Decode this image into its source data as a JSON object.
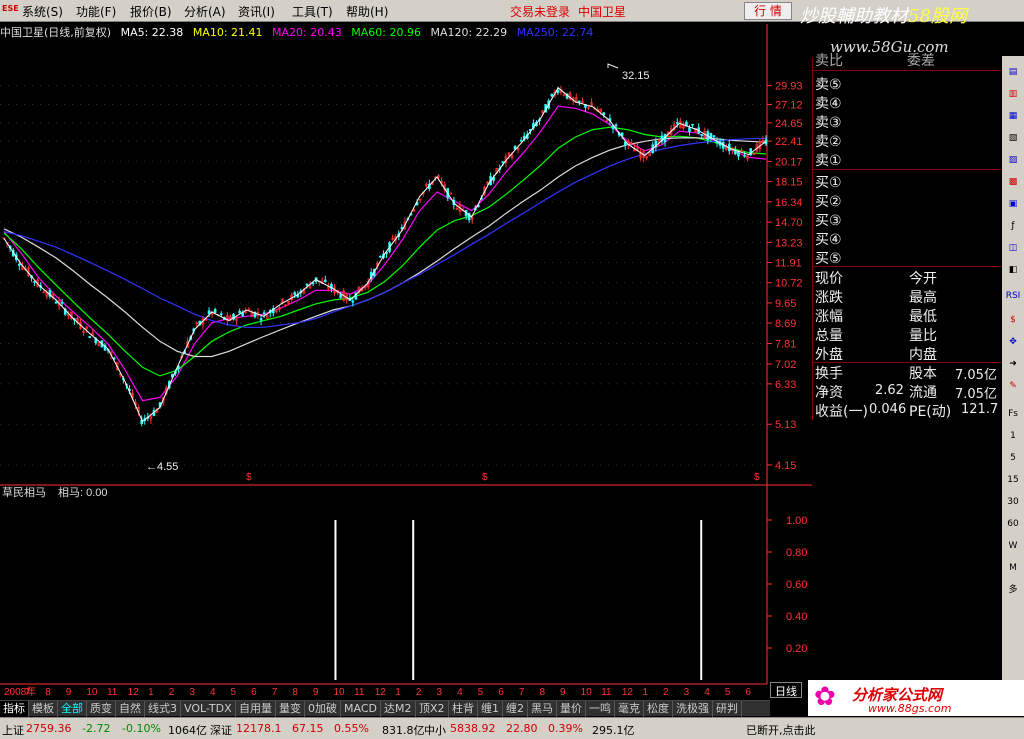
{
  "menubar": {
    "logo": "ESE",
    "items": [
      "系统(S)",
      "功能(F)",
      "报价(B)",
      "分析(A)",
      "资讯(I)",
      "工具(T)",
      "帮助(H)"
    ],
    "status": "交易未登录",
    "stock_name": "中国卫星",
    "quote_button": "行 情"
  },
  "watermark": {
    "title_main": "炒股輔助教材",
    "title_accent": "58股网",
    "url": "www.58Gu.com"
  },
  "chart_header": {
    "title": "中国卫星(日线,前复权)",
    "ma": [
      {
        "label": "MA5: 22.38",
        "color": "#ffffff"
      },
      {
        "label": "MA10: 21.41",
        "color": "#ffff00"
      },
      {
        "label": "MA20: 20.43",
        "color": "#ff00ff"
      },
      {
        "label": "MA60: 20.96",
        "color": "#00ff00"
      },
      {
        "label": "MA120: 22.29",
        "color": "#dddddd"
      },
      {
        "label": "MA250: 22.74",
        "color": "#3333ff"
      }
    ]
  },
  "colors": {
    "up": "#ff3333",
    "down": "#33ffff",
    "axis": "#ff3333",
    "ma5": "#ffffff",
    "ma10": "#ffff00",
    "ma20": "#ff00ff",
    "ma60": "#00ff00",
    "ma120": "#dddddd",
    "ma250": "#3333ff"
  },
  "chart_data": [
    {
      "type": "line",
      "title": "中国卫星(日线,前复权)",
      "y_ticks": [
        "29.93",
        "27.12",
        "24.65",
        "22.41",
        "20.17",
        "18.15",
        "16.34",
        "14.70",
        "13.23",
        "11.91",
        "10.72",
        "9.65",
        "8.69",
        "7.81",
        "7.02",
        "6.33",
        "5.13",
        "4.15"
      ],
      "annotations": [
        {
          "label": "32.15"
        },
        {
          "label": "4.55"
        }
      ],
      "x_labels": [
        "2008年",
        "7",
        "8",
        "9",
        "10",
        "11",
        "12",
        "1",
        "2",
        "3",
        "4",
        "5",
        "6",
        "7",
        "8",
        "9",
        "10",
        "11",
        "12",
        "1",
        "2",
        "3",
        "4",
        "5",
        "6",
        "7",
        "8",
        "9",
        "10",
        "11",
        "12",
        "1",
        "2",
        "3",
        "4",
        "5",
        "6"
      ],
      "series": [
        {
          "name": "MA5",
          "values": [
            13.5,
            11.8,
            10.6,
            9.8,
            8.9,
            8.2,
            7.6,
            6.4,
            5.2,
            5.6,
            6.9,
            8.4,
            9.2,
            8.8,
            9.3,
            9.0,
            9.6,
            10.1,
            10.9,
            10.4,
            9.8,
            10.7,
            12.5,
            14.1,
            16.8,
            18.6,
            16.2,
            15.1,
            18.0,
            20.3,
            22.5,
            25.3,
            29.6,
            27.5,
            26.8,
            24.9,
            22.1,
            20.8,
            22.5,
            24.6,
            23.8,
            22.6,
            21.5,
            20.9,
            22.4
          ]
        },
        {
          "name": "MA20",
          "values": [
            14.0,
            12.5,
            11.0,
            10.0,
            9.2,
            8.5,
            7.8,
            6.8,
            5.8,
            5.9,
            6.6,
            7.8,
            8.7,
            8.9,
            9.0,
            9.1,
            9.4,
            9.8,
            10.3,
            10.3,
            10.1,
            10.6,
            11.8,
            13.4,
            15.6,
            17.2,
            16.4,
            15.6,
            17.0,
            19.1,
            21.1,
            23.6,
            26.9,
            26.6,
            25.8,
            24.4,
            22.4,
            21.3,
            22.0,
            23.6,
            23.4,
            22.5,
            21.4,
            20.6,
            20.4
          ]
        },
        {
          "name": "MA60",
          "values": [
            13.9,
            12.8,
            11.6,
            10.6,
            9.7,
            8.9,
            8.2,
            7.5,
            6.9,
            6.6,
            6.8,
            7.3,
            7.9,
            8.3,
            8.6,
            8.8,
            9.0,
            9.3,
            9.6,
            9.8,
            9.9,
            10.2,
            10.8,
            11.7,
            12.9,
            14.1,
            14.8,
            15.2,
            15.9,
            17.0,
            18.3,
            19.8,
            21.6,
            22.9,
            23.8,
            24.1,
            23.8,
            23.2,
            22.9,
            23.0,
            22.8,
            22.3,
            21.6,
            21.1,
            20.96
          ]
        },
        {
          "name": "MA120",
          "values": [
            14.2,
            13.6,
            12.9,
            12.2,
            11.4,
            10.6,
            9.9,
            9.2,
            8.5,
            7.9,
            7.5,
            7.3,
            7.3,
            7.5,
            7.8,
            8.1,
            8.4,
            8.7,
            9.0,
            9.3,
            9.5,
            9.8,
            10.2,
            10.7,
            11.3,
            12.0,
            12.8,
            13.6,
            14.4,
            15.4,
            16.4,
            17.4,
            18.6,
            19.7,
            20.6,
            21.4,
            22.0,
            22.4,
            22.7,
            22.8,
            22.8,
            22.7,
            22.5,
            22.4,
            22.29
          ]
        },
        {
          "name": "MA250",
          "values": [
            14.0,
            13.7,
            13.3,
            12.9,
            12.4,
            11.9,
            11.4,
            10.9,
            10.4,
            9.9,
            9.5,
            9.1,
            8.8,
            8.6,
            8.5,
            8.5,
            8.6,
            8.7,
            8.9,
            9.2,
            9.5,
            9.8,
            10.2,
            10.7,
            11.2,
            11.8,
            12.4,
            13.1,
            13.8,
            14.6,
            15.4,
            16.3,
            17.2,
            18.1,
            18.9,
            19.7,
            20.4,
            21.0,
            21.5,
            21.9,
            22.2,
            22.4,
            22.6,
            22.7,
            22.74
          ]
        }
      ]
    },
    {
      "type": "bar",
      "title": "草民相马",
      "value_label": "相马: 0.00",
      "y_ticks": [
        "1.00",
        "0.80",
        "0.60",
        "0.40",
        "0.20"
      ],
      "ylim": [
        0,
        1.1
      ],
      "signals": [
        {
          "position": 0.435,
          "value": 1.0
        },
        {
          "position": 0.537,
          "value": 1.0
        },
        {
          "position": 0.915,
          "value": 1.0
        }
      ]
    }
  ],
  "orderbook": {
    "ask_header": "卖比",
    "ask_diff": "委差",
    "asks": [
      "卖⑤",
      "卖④",
      "卖③",
      "卖②",
      "卖①"
    ],
    "bids": [
      "买①",
      "买②",
      "买③",
      "买④",
      "买⑤"
    ],
    "stats_left": [
      "现价",
      "涨跌",
      "涨幅",
      "总量",
      "外盘"
    ],
    "stats_right": [
      "今开",
      "最高",
      "最低",
      "量比",
      "内盘"
    ],
    "turnover_label": "换手",
    "equity_label": "股本",
    "equity_value": "7.05亿",
    "net_asset_label": "净资",
    "net_asset_value": "2.62",
    "float_label": "流通",
    "float_value": "7.05亿",
    "eps_label": "收益(一)",
    "eps_value": "0.046",
    "pe_label": "PE(动)",
    "pe_value": "121.7"
  },
  "tabs": [
    "指标",
    "模板",
    "全部",
    "质变",
    "自然",
    "线式3",
    "VOL-TDX",
    "自用量",
    "量变",
    "0加破",
    "MACD",
    "达M2",
    "顶X2",
    "柱背",
    "缠1",
    "缠2",
    "黑马",
    "量价",
    "一鸣",
    "毫克",
    "松度",
    "洗极强",
    "研判"
  ],
  "day_button": "日线",
  "statusbar": {
    "sh_label": "上证",
    "sh_index": "2759.36",
    "sh_change": "-2.72",
    "sh_pct": "-0.10%",
    "sh_amount": "1064亿",
    "sz_label": "深证",
    "sz_index": "12178.1",
    "sz_change": "67.15",
    "sz_pct": "0.55%",
    "sz_amount": "831.8亿",
    "zx_label": "中小",
    "zx_index": "5838.92",
    "zx_change": "22.80",
    "zx_pct": "0.39%",
    "zx_amount": "295.1亿",
    "conn": "已断开,点击此"
  },
  "brand": {
    "name": "分析家公式网",
    "url": "www.88gs.com"
  },
  "rightbar": [
    "RSI",
    "Fs",
    "1",
    "5",
    "15",
    "30",
    "60",
    "W",
    "M",
    "多"
  ]
}
